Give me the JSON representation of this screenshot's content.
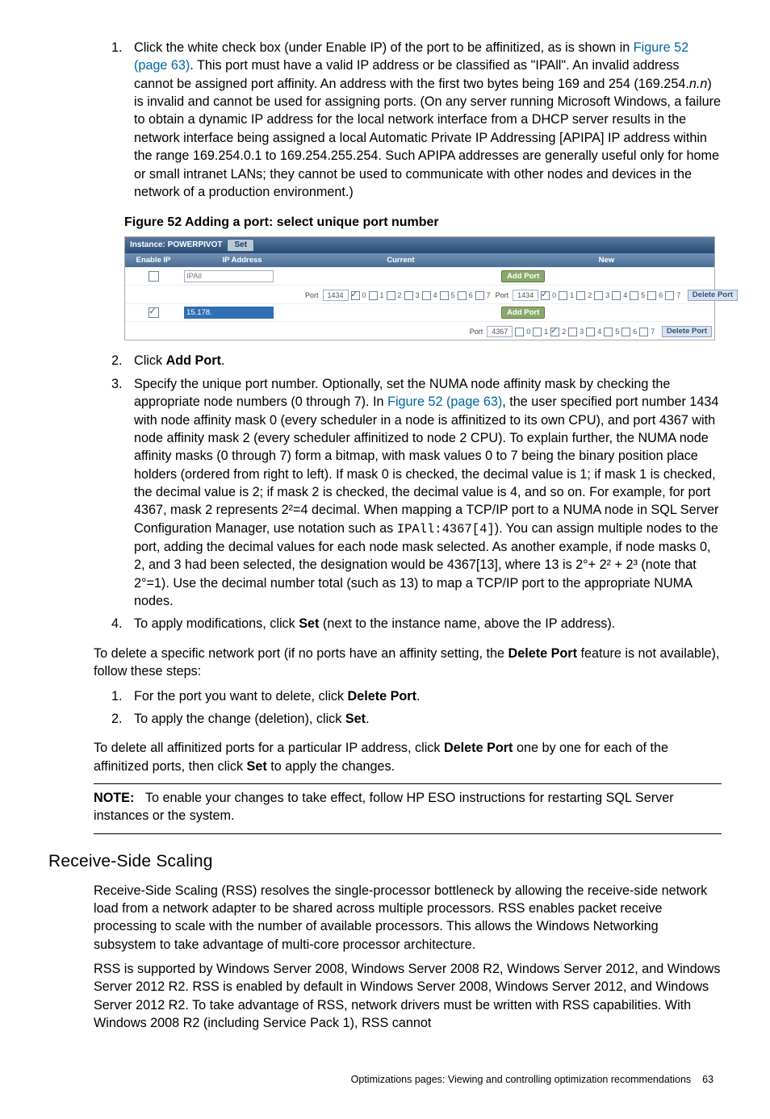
{
  "doc": {
    "step1_a": "Click the white check box (under Enable IP) of the port to be affinitized, as is shown in ",
    "step1_link": "Figure 52 (page 63)",
    "step1_b": ". This port must have a valid IP address or be classified as \"IPAll\". An invalid address cannot be assigned port affinity. An address with the first two bytes being 169 and 254 (169.254.",
    "step1_ital": "n.n",
    "step1_c": ") is invalid and cannot be used for assigning ports. (On any server running Microsoft Windows, a failure to obtain a dynamic IP address for the local network interface from a DHCP server results in the network interface being assigned a local Automatic Private IP Addressing [APIPA] IP address within the range 169.254.0.1 to 169.254.255.254. Such APIPA addresses are generally useful only for home or small intranet LANs; they cannot be used to communicate with other nodes and devices in the network of a production environment.)",
    "fig_caption": "Figure 52 Adding a port: select unique port number",
    "step2_a": "Click ",
    "step2_b": "Add Port",
    "step2_c": ".",
    "step3_a": "Specify the unique port number. Optionally, set the NUMA node affinity mask by checking the appropriate node numbers (0 through 7). In ",
    "step3_link": "Figure 52 (page 63)",
    "step3_b": ", the user specified port number 1434 with node affinity mask 0 (every scheduler in a node is affinitized to its own CPU), and port 4367 with node affinity mask 2 (every scheduler affinitized to node 2 CPU). To explain further, the NUMA node affinity masks (0 through 7) form a bitmap, with mask values 0 to 7 being the binary position place holders (ordered from right to left). If mask 0 is checked, the decimal value is 1; if mask 1 is checked, the decimal value is 2; if mask 2 is checked, the decimal value is 4, and so on. For example, for port 4367, mask 2 represents 2²=4 decimal. When mapping a TCP/IP port to a NUMA node in SQL Server Configuration Manager, use notation such as ",
    "step3_code": "IPAll:4367[4]",
    "step3_c": "). You can assign multiple nodes to the port, adding the decimal values for each node mask selected. As another example, if node masks 0, 2, and 3 had been selected, the designation would be 4367[13], where 13 is 2°+ 2² + 2³ (note that 2°=1). Use the decimal number total (such as 13) to map a TCP/IP port to the appropriate NUMA nodes.",
    "step4_a": "To apply modifications, click ",
    "step4_b": "Set",
    "step4_c": " (next to the instance name, above the IP address).",
    "para1_a": "To delete a specific network port  (if no ports have an affinity setting, the ",
    "para1_b": "Delete Port",
    "para1_c": " feature is not available), follow these steps:",
    "del1_a": "For the port you want to delete, click ",
    "del1_b": "Delete Port",
    "del1_c": ".",
    "del2_a": "To apply the change (deletion), click ",
    "del2_b": "Set",
    "del2_c": ".",
    "para2_a": "To delete all affinitized ports for a particular IP address, click ",
    "para2_b": "Delete Port",
    "para2_c": " one by one for each of the affinitized ports, then click ",
    "para2_d": "Set",
    "para2_e": " to apply the changes.",
    "note_label": "NOTE:",
    "note_text": "To enable your changes to take effect, follow HP ESO instructions for restarting SQL Server instances or the system.",
    "h2": "Receive-Side Scaling",
    "rss1": "Receive-Side Scaling (RSS) resolves the single-processor bottleneck by allowing the receive-side network load from a network adapter to be shared across multiple processors. RSS enables packet receive processing to scale with the number of available processors. This allows the Windows Networking subsystem to take advantage of multi-core processor architecture.",
    "rss2": "RSS is supported by Windows Server 2008, Windows Server 2008 R2, Windows Server 2012, and Windows Server 2012 R2. RSS is enabled by default in Windows Server 2008, Windows Server 2012, and Windows Server 2012 R2. To take advantage of RSS, network drivers must be written with RSS capabilities. With Windows 2008 R2 (including Service Pack 1), RSS cannot",
    "footer_text": "Optimizations pages: Viewing and controlling optimization recommendations",
    "footer_page": "63"
  },
  "fig": {
    "instance_label": "Instance: POWERPIVOT",
    "set_btn": "Set",
    "hdr_enable": "Enable IP",
    "hdr_ip": "IP Address",
    "hdr_current": "Current",
    "hdr_new": "New",
    "ip1": "IPAll",
    "ip2": "15.178.",
    "port_lbl": "Port",
    "port1": "1434",
    "port2": "1434",
    "port3": "4367",
    "addport": "Add Port",
    "delport": "Delete Port",
    "nodes": [
      "0",
      "1",
      "2",
      "3",
      "4",
      "5",
      "6",
      "7"
    ]
  }
}
